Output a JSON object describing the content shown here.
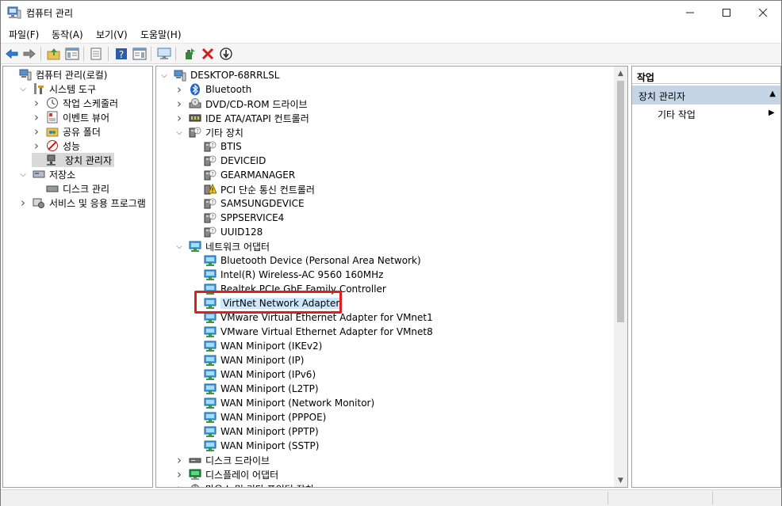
{
  "window": {
    "title": "컴퓨터 관리"
  },
  "menu": [
    "파일(F)",
    "동작(A)",
    "보기(V)",
    "도움말(H)"
  ],
  "toolbar_icons": [
    "back-icon",
    "forward-icon",
    "up-folder-icon",
    "show-hide-tree-icon",
    "properties-icon",
    "help-icon",
    "show-hide-action-icon",
    "monitor-icon",
    "update-driver-icon",
    "uninstall-icon",
    "disable-device-icon"
  ],
  "left_tree": [
    {
      "label": "컴퓨터 관리(로컬)",
      "icon": "computer-management-icon",
      "arrow": "",
      "indent": 0
    },
    {
      "label": "시스템 도구",
      "icon": "tools-icon",
      "arrow": "v",
      "indent": 1
    },
    {
      "label": "작업 스케줄러",
      "icon": "clock-icon",
      "arrow": ">",
      "indent": 2
    },
    {
      "label": "이벤트 뷰어",
      "icon": "event-viewer-icon",
      "arrow": ">",
      "indent": 2
    },
    {
      "label": "공유 폴더",
      "icon": "shared-folder-icon",
      "arrow": ">",
      "indent": 2
    },
    {
      "label": "성능",
      "icon": "performance-icon",
      "arrow": ">",
      "indent": 2
    },
    {
      "label": "장치 관리자",
      "icon": "device-manager-icon",
      "arrow": "",
      "indent": 2,
      "selected": true
    },
    {
      "label": "저장소",
      "icon": "storage-icon",
      "arrow": "v",
      "indent": 1
    },
    {
      "label": "디스크 관리",
      "icon": "disk-management-icon",
      "arrow": "",
      "indent": 2
    },
    {
      "label": "서비스 및 응용 프로그램",
      "icon": "services-icon",
      "arrow": ">",
      "indent": 1
    }
  ],
  "device_tree": [
    {
      "label": "DESKTOP-68RRLSL",
      "icon": "computer-icon",
      "arrow": "v",
      "indent": 0
    },
    {
      "label": "Bluetooth",
      "icon": "bluetooth-icon",
      "arrow": ">",
      "indent": 1
    },
    {
      "label": "DVD/CD-ROM 드라이브",
      "icon": "dvd-drive-icon",
      "arrow": ">",
      "indent": 1
    },
    {
      "label": "IDE ATA/ATAPI 컨트롤러",
      "icon": "ide-controller-icon",
      "arrow": ">",
      "indent": 1
    },
    {
      "label": "기타 장치",
      "icon": "other-devices-icon",
      "arrow": "v",
      "indent": 1
    },
    {
      "label": "BTIS",
      "icon": "unknown-device-icon",
      "arrow": "",
      "indent": 2
    },
    {
      "label": "DEVICEID",
      "icon": "unknown-device-icon",
      "arrow": "",
      "indent": 2
    },
    {
      "label": "GEARMANAGER",
      "icon": "unknown-device-icon",
      "arrow": "",
      "indent": 2
    },
    {
      "label": "PCI 단순 통신 컨트롤러",
      "icon": "warning-device-icon",
      "arrow": "",
      "indent": 2
    },
    {
      "label": "SAMSUNGDEVICE",
      "icon": "unknown-device-icon",
      "arrow": "",
      "indent": 2
    },
    {
      "label": "SPPSERVICE4",
      "icon": "unknown-device-icon",
      "arrow": "",
      "indent": 2
    },
    {
      "label": "UUID128",
      "icon": "unknown-device-icon",
      "arrow": "",
      "indent": 2
    },
    {
      "label": "네트워크 어댑터",
      "icon": "network-adapter-icon",
      "arrow": "v",
      "indent": 1
    },
    {
      "label": "Bluetooth Device (Personal Area Network)",
      "icon": "network-adapter-icon",
      "arrow": "",
      "indent": 2
    },
    {
      "label": "Intel(R) Wireless-AC 9560 160MHz",
      "icon": "network-adapter-icon",
      "arrow": "",
      "indent": 2
    },
    {
      "label": "Realtek PCIe GbE Family Controller",
      "icon": "network-adapter-icon",
      "arrow": "",
      "indent": 2
    },
    {
      "label": "VirtNet Network Adapter",
      "icon": "network-adapter-icon",
      "arrow": "",
      "indent": 2,
      "highlighted": true
    },
    {
      "label": "VMware Virtual Ethernet Adapter for VMnet1",
      "icon": "network-adapter-icon",
      "arrow": "",
      "indent": 2
    },
    {
      "label": "VMware Virtual Ethernet Adapter for VMnet8",
      "icon": "network-adapter-icon",
      "arrow": "",
      "indent": 2
    },
    {
      "label": "WAN Miniport (IKEv2)",
      "icon": "network-adapter-icon",
      "arrow": "",
      "indent": 2
    },
    {
      "label": "WAN Miniport (IP)",
      "icon": "network-adapter-icon",
      "arrow": "",
      "indent": 2
    },
    {
      "label": "WAN Miniport (IPv6)",
      "icon": "network-adapter-icon",
      "arrow": "",
      "indent": 2
    },
    {
      "label": "WAN Miniport (L2TP)",
      "icon": "network-adapter-icon",
      "arrow": "",
      "indent": 2
    },
    {
      "label": "WAN Miniport (Network Monitor)",
      "icon": "network-adapter-icon",
      "arrow": "",
      "indent": 2
    },
    {
      "label": "WAN Miniport (PPPOE)",
      "icon": "network-adapter-icon",
      "arrow": "",
      "indent": 2
    },
    {
      "label": "WAN Miniport (PPTP)",
      "icon": "network-adapter-icon",
      "arrow": "",
      "indent": 2
    },
    {
      "label": "WAN Miniport (SSTP)",
      "icon": "network-adapter-icon",
      "arrow": "",
      "indent": 2
    },
    {
      "label": "디스크 드라이브",
      "icon": "disk-drive-icon",
      "arrow": ">",
      "indent": 1
    },
    {
      "label": "디스플레이 어댑터",
      "icon": "display-adapter-icon",
      "arrow": ">",
      "indent": 1
    },
    {
      "label": "마우스 및 기타 포인팅 장치",
      "icon": "mouse-icon",
      "arrow": ">",
      "indent": 1
    }
  ],
  "actions": {
    "header": "작업",
    "section": "장치 관리자",
    "item": "기타 작업"
  }
}
